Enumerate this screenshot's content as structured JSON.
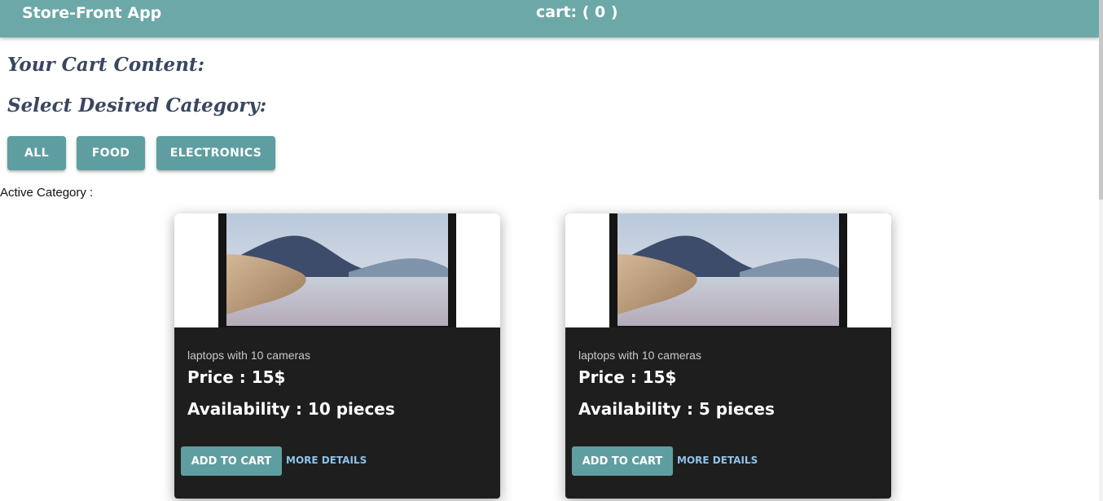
{
  "appbar": {
    "title": "Store-Front App",
    "cart_label": "cart: ( 0 )"
  },
  "headings": {
    "cart_content": "Your Cart Content:",
    "select_category": "Select Desired Category:"
  },
  "categories": [
    {
      "label": "ALL"
    },
    {
      "label": "FOOD"
    },
    {
      "label": "ELECTRONICS"
    }
  ],
  "active_category_label": "Active Category :",
  "products": [
    {
      "description": "laptops with 10 cameras",
      "price": "Price : 15$",
      "availability": "Availability : 10 pieces",
      "add_label": "ADD TO CART",
      "details_label": "MORE DETAILS"
    },
    {
      "description": "laptops with 10 cameras",
      "price": "Price : 15$",
      "availability": "Availability : 5 pieces",
      "add_label": "ADD TO CART",
      "details_label": "MORE DETAILS"
    }
  ],
  "colors": {
    "appbar": "#6ca8a8",
    "button": "#5f9ea0",
    "card": "#1e1e1e",
    "heading": "#3a4660",
    "link": "#8ec2e8"
  }
}
